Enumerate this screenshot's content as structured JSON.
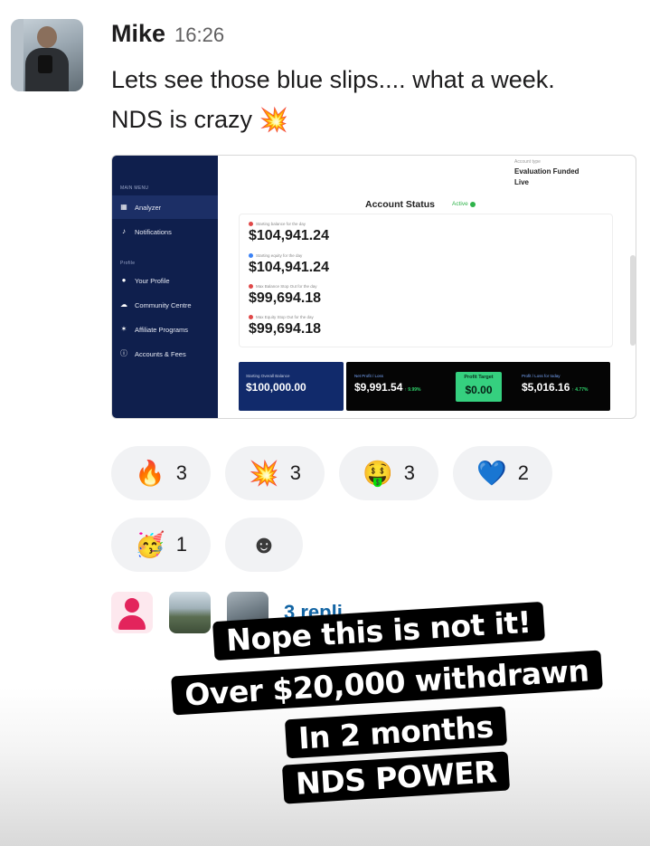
{
  "message": {
    "author": "Mike",
    "time": "16:26",
    "text_line1": "Lets see those blue slips.... what a week.",
    "text_line2": "NDS is crazy",
    "text_emoji": "💥"
  },
  "attachment": {
    "account_type_label": "Account type",
    "account_type_line1": "Evaluation Funded",
    "account_type_line2": "Live",
    "sidebar": {
      "section_main": "MAIN MENU",
      "section_profile": "Profile",
      "items": [
        {
          "label": "Analyzer",
          "icon": "grid-icon"
        },
        {
          "label": "Notifications",
          "icon": "bell-icon"
        },
        {
          "label": "Your Profile",
          "icon": "user-icon"
        },
        {
          "label": "Community Centre",
          "icon": "community-icon"
        },
        {
          "label": "Affiliate Programs",
          "icon": "affiliate-icon"
        },
        {
          "label": "Accounts & Fees",
          "icon": "info-icon"
        }
      ]
    },
    "status_title": "Account Status",
    "status_badge": "Active",
    "balances": [
      {
        "label": "Starting balance for the day",
        "value": "$104,941.24",
        "dot_color": "#e04848"
      },
      {
        "label": "Starting equity for the day",
        "value": "$104,941.24",
        "dot_color": "#3b82f6"
      },
      {
        "label": "Max Balance Stop Out for the day",
        "value": "$99,694.18",
        "dot_color": "#e04848"
      },
      {
        "label": "Max Equity Stop Out for the day",
        "value": "$99,694.18",
        "dot_color": "#e04848"
      }
    ],
    "summary": {
      "overall_label": "Starting Overall Balance",
      "overall_value": "$100,000.00",
      "net_label": "Net Profit / Loss",
      "net_value": "$9,991.54",
      "net_pct": "↑ 9.99%",
      "target_label": "Profit Target",
      "target_value": "$0.00",
      "today_label": "Profit / Loss for today",
      "today_value": "$5,016.16",
      "today_pct": "↑ 4.77%"
    }
  },
  "reactions": [
    {
      "emoji": "🔥",
      "count": "3"
    },
    {
      "emoji": "💥",
      "count": "3"
    },
    {
      "emoji": "🤑",
      "count": "3"
    },
    {
      "emoji": "💙",
      "count": "2"
    },
    {
      "emoji": "🥳",
      "count": "1"
    }
  ],
  "add_reaction_icon": "☻",
  "replies_text": "3 repli",
  "overlay": {
    "line1": "Nope this is not it!",
    "line2": "Over $20,000 withdrawn",
    "line3": "In 2 months",
    "line4": "NDS POWER"
  },
  "colors": {
    "sidebar_bg": "#0f1f4d",
    "link_blue": "#1264a3",
    "profit_green": "#35d07f",
    "active_green": "#2fb34a"
  }
}
